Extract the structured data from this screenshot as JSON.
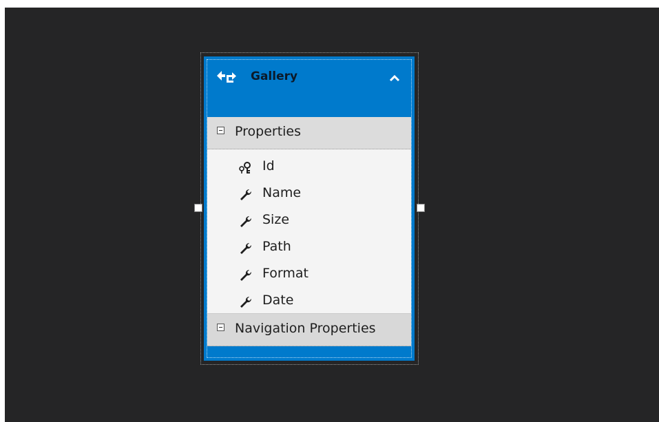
{
  "entity": {
    "title": "Gallery",
    "entity_icon": "entity-type-icon",
    "collapse_icon": "chevron-up-icon"
  },
  "sections": {
    "properties_label": "Properties",
    "navigation_label": "Navigation Properties"
  },
  "properties": [
    {
      "label": "Id",
      "icon": "key-icon"
    },
    {
      "label": "Name",
      "icon": "wrench-icon"
    },
    {
      "label": "Size",
      "icon": "wrench-icon"
    },
    {
      "label": "Path",
      "icon": "wrench-icon"
    },
    {
      "label": "Format",
      "icon": "wrench-icon"
    },
    {
      "label": "Date",
      "icon": "wrench-icon"
    }
  ],
  "colors": {
    "canvas": "#252526",
    "entity_header": "#007acc",
    "section_header": "#dcdcdc",
    "list_background": "#f4f4f4"
  }
}
